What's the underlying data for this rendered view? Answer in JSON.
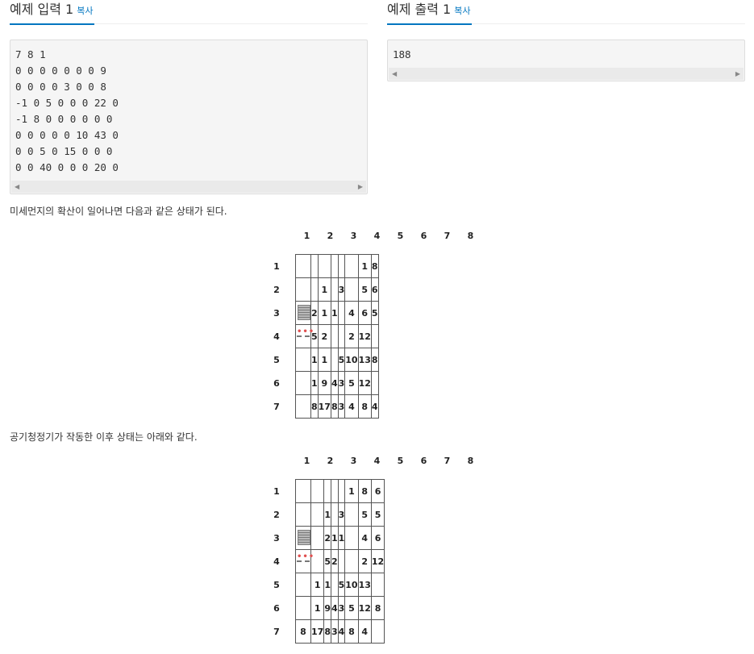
{
  "input_section": {
    "title": "예제 입력 1",
    "copy_label": "복사",
    "lines": [
      "7 8 1",
      "0 0 0 0 0 0 0 9",
      "0 0 0 0 3 0 0 8",
      "-1 0 5 0 0 0 22 0",
      "-1 8 0 0 0 0 0 0",
      "0 0 0 0 0 10 43 0",
      "0 0 5 0 15 0 0 0",
      "0 0 40 0 0 0 20 0"
    ]
  },
  "output_section": {
    "title": "예제 출력 1",
    "copy_label": "복사",
    "lines": [
      "188"
    ]
  },
  "scroll_arrows": {
    "left": "◀",
    "right": "▶"
  },
  "paragraph1": "미세먼지의 확산이 일어나면 다음과 같은 상태가 된다.",
  "paragraph2": "공기청정기가 작동한 이후 상태는 아래와 같다.",
  "grid1": {
    "col_headers": [
      "1",
      "2",
      "3",
      "4",
      "5",
      "6",
      "7",
      "8"
    ],
    "row_headers": [
      "1",
      "2",
      "3",
      "4",
      "5",
      "6",
      "7"
    ],
    "rows": [
      [
        "",
        "",
        "",
        "",
        "",
        "",
        "1",
        "8"
      ],
      [
        "",
        "",
        "1",
        "",
        "3",
        "",
        "5",
        "6"
      ],
      [
        "PURIFIER_TOP",
        "2",
        "1",
        "1",
        "",
        "4",
        "6",
        "5"
      ],
      [
        "PURIFIER_BOTTOM",
        "5",
        "2",
        "",
        "",
        "2",
        "12",
        ""
      ],
      [
        "",
        "1",
        "1",
        "",
        "5",
        "10",
        "13",
        "8"
      ],
      [
        "",
        "1",
        "9",
        "4",
        "3",
        "5",
        "12",
        ""
      ],
      [
        "",
        "8",
        "17",
        "8",
        "3",
        "4",
        "8",
        "4"
      ]
    ]
  },
  "grid2": {
    "col_headers": [
      "1",
      "2",
      "3",
      "4",
      "5",
      "6",
      "7",
      "8"
    ],
    "row_headers": [
      "1",
      "2",
      "3",
      "4",
      "5",
      "6",
      "7"
    ],
    "rows": [
      [
        "",
        "",
        "",
        "",
        "",
        "1",
        "8",
        "6"
      ],
      [
        "",
        "",
        "1",
        "",
        "3",
        "",
        "5",
        "5"
      ],
      [
        "PURIFIER_TOP",
        "",
        "2",
        "1",
        "1",
        "",
        "4",
        "6"
      ],
      [
        "PURIFIER_BOTTOM",
        "",
        "5",
        "2",
        "",
        "",
        "2",
        "12"
      ],
      [
        "",
        "1",
        "1",
        "",
        "5",
        "10",
        "13",
        ""
      ],
      [
        "",
        "1",
        "9",
        "4",
        "3",
        "5",
        "12",
        "8"
      ],
      [
        "8",
        "17",
        "8",
        "3",
        "4",
        "8",
        "4",
        ""
      ]
    ]
  },
  "icons": {
    "purifier": "air-purifier-icon"
  },
  "colors": {
    "accent": "#0076c0",
    "box_bg": "#f5f5f5",
    "border": "#dddddd"
  }
}
